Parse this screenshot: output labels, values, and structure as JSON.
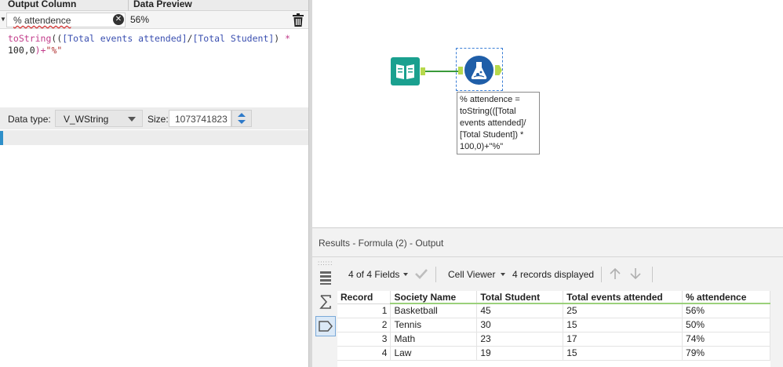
{
  "formula_panel": {
    "col_output": "Output Column",
    "col_preview": "Data Preview",
    "field_name": "% attendence",
    "preview_value": "56%",
    "expression_line1": [
      "toString",
      "((",
      "[Total events attended]",
      "/",
      "[Total Student]",
      ") ",
      "*"
    ],
    "expression_line2": [
      "100",
      ",",
      "0",
      ")+",
      "\"%\""
    ],
    "data_type_label": "Data type:",
    "data_type_value": "V_WString",
    "size_label": "Size:",
    "size_value": "1073741823"
  },
  "canvas": {
    "annotation": "% attendence =\ntoString(([Total\nevents attended]/\n[Total Student]) *\n100,0)+\"%\""
  },
  "results": {
    "title": "Results - Formula (2) - Output",
    "fields_label": "4 of 4 Fields",
    "cell_viewer_label": "Cell Viewer",
    "records_label": "4 records displayed",
    "columns": [
      "Record",
      "Society Name",
      "Total Student",
      "Total events attended",
      "% attendence"
    ],
    "rows": [
      {
        "record": "1",
        "name": "Basketball",
        "students": "45",
        "events": "25",
        "attend": "56%"
      },
      {
        "record": "2",
        "name": "Tennis",
        "students": "30",
        "events": "15",
        "attend": "50%"
      },
      {
        "record": "3",
        "name": "Math",
        "students": "23",
        "events": "17",
        "attend": "74%"
      },
      {
        "record": "4",
        "name": "Law",
        "students": "19",
        "events": "15",
        "attend": "79%"
      }
    ]
  },
  "colors": {
    "accent_blue": "#2e8fc9",
    "input_tool": "#1aa08f",
    "formula_tool": "#1f5ea8",
    "anchor_green": "#b7d94c"
  }
}
